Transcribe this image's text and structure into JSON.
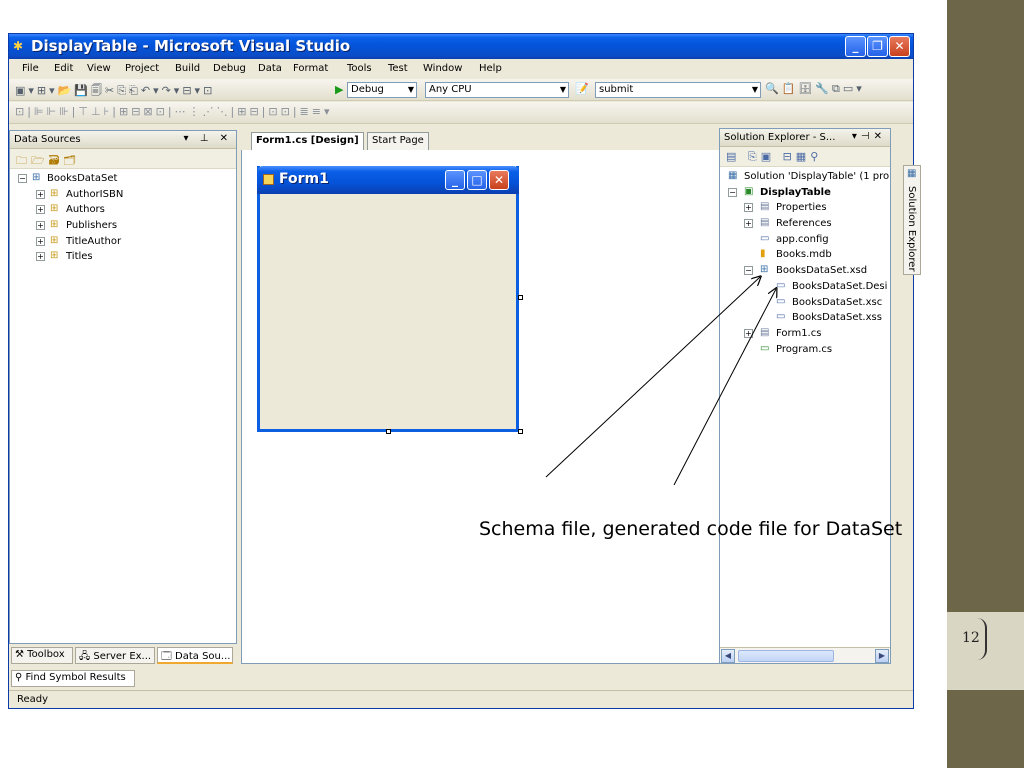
{
  "slide": {
    "page_number": "12"
  },
  "window": {
    "title": "DisplayTable - Microsoft Visual Studio",
    "colors": {
      "titlebar": "#0453d8",
      "chrome": "#ece9d8"
    }
  },
  "menu": [
    "File",
    "Edit",
    "View",
    "Project",
    "Build",
    "Debug",
    "Data",
    "Format",
    "Tools",
    "Test",
    "Window",
    "Help"
  ],
  "toolbar": {
    "config": "Debug",
    "platform": "Any CPU",
    "find": "submit"
  },
  "data_sources": {
    "title": "Data Sources",
    "root": "BooksDataSet",
    "items": [
      "AuthorISBN",
      "Authors",
      "Publishers",
      "TitleAuthor",
      "Titles"
    ]
  },
  "bottom_tabs": [
    "Toolbox",
    "Server Ex...",
    "Data Sou..."
  ],
  "find_symbol": "Find Symbol Results",
  "status": "Ready",
  "doc_tabs": [
    "Form1.cs [Design]",
    "Start Page"
  ],
  "form": {
    "title": "Form1"
  },
  "solution_explorer": {
    "title": "Solution Explorer - S...",
    "vertical_tab": "Solution Explorer",
    "solution": "Solution 'DisplayTable' (1 pro",
    "project": "DisplayTable",
    "items": {
      "properties": "Properties",
      "references": "References",
      "app_config": "app.config",
      "books_mdb": "Books.mdb",
      "xsd": "BooksDataSet.xsd",
      "designer": "BooksDataSet.Desi",
      "xsc": "BooksDataSet.xsc",
      "xss": "BooksDataSet.xss",
      "form1": "Form1.cs",
      "program": "Program.cs"
    }
  },
  "annotation": "Schema file, generated code file for DataSet"
}
